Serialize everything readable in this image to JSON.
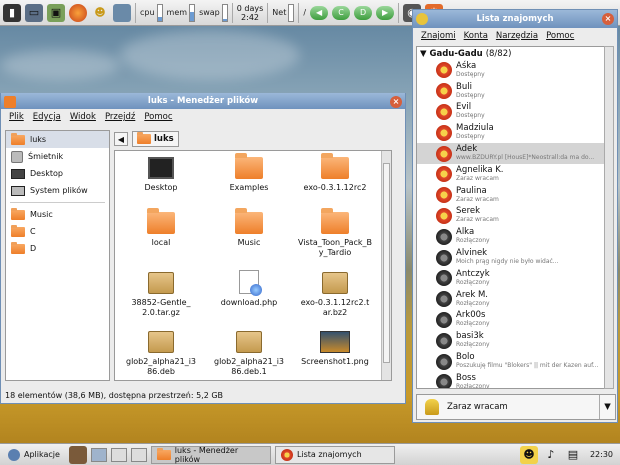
{
  "top_panel": {
    "launchers": [
      "terminal-icon",
      "display-icon",
      "image-icon",
      "firefox-icon",
      "user-icon",
      "workspace-icon"
    ],
    "cpu_label": "cpu",
    "cpu_level": 0.2,
    "mem_label": "mem",
    "mem_level": 0.55,
    "swap_label": "swap",
    "swap_level": 0.1,
    "uptime_days": "0 days",
    "uptime_time": "2:42",
    "net_label": "Net",
    "slash": "/",
    "drives": [
      "C",
      "D"
    ]
  },
  "file_manager": {
    "title": "luks - Menedżer plików",
    "menu": [
      "Plik",
      "Edycja",
      "Widok",
      "Przejdź",
      "Pomoc"
    ],
    "sidebar": [
      {
        "label": "luks",
        "icon": "home-folder-icon",
        "selected": true
      },
      {
        "label": "Śmietnik",
        "icon": "trash-icon"
      },
      {
        "label": "Desktop",
        "icon": "desktop-icon"
      },
      {
        "label": "System plików",
        "icon": "drive-icon"
      },
      {
        "label": "Music",
        "icon": "folder-icon"
      },
      {
        "label": "C",
        "icon": "folder-icon"
      },
      {
        "label": "D",
        "icon": "folder-icon"
      }
    ],
    "path_button": "luks",
    "files": [
      {
        "name": "Desktop",
        "icon": "film-icon"
      },
      {
        "name": "Examples",
        "icon": "folder-icon"
      },
      {
        "name": "exo-0.3.1.12rc2",
        "icon": "folder-icon"
      },
      {
        "name": "local",
        "icon": "folder-icon"
      },
      {
        "name": "Music",
        "icon": "folder-icon"
      },
      {
        "name": "Vista_Toon_Pack_By_Tardio",
        "icon": "folder-icon"
      },
      {
        "name": "38852-Gentle_2.0.tar.gz",
        "icon": "package-icon"
      },
      {
        "name": "download.php",
        "icon": "php-icon"
      },
      {
        "name": "exo-0.3.1.12rc2.tar.bz2",
        "icon": "package-icon"
      },
      {
        "name": "glob2_alpha21_i386.deb",
        "icon": "package-icon"
      },
      {
        "name": "glob2_alpha21_i386.deb.1",
        "icon": "package-icon"
      },
      {
        "name": "Screenshot1.png",
        "icon": "image-icon"
      }
    ],
    "status": "18 elementów (38,6 MB), dostępna przestrzeń: 5,2 GB"
  },
  "messenger": {
    "title": "Lista znajomych",
    "menu": [
      "Znajomi",
      "Konta",
      "Narzędzia",
      "Pomoc"
    ],
    "group_name": "Gadu-Gadu",
    "group_count": "(8/82)",
    "contacts": [
      {
        "name": "Aśka",
        "status": "Dostępny",
        "online": true
      },
      {
        "name": "Buli",
        "status": "Dostępny",
        "online": true
      },
      {
        "name": "Evil",
        "status": "Dostępny",
        "online": true
      },
      {
        "name": "Madziula",
        "status": "Dostępny",
        "online": true
      },
      {
        "name": "Adek",
        "status": "www.BZDURY.pl [HousE]*Neostrall:da ma do...",
        "online": true,
        "selected": true
      },
      {
        "name": "Agnelika K.",
        "status": "Zaraz wracam",
        "online": true
      },
      {
        "name": "Paulina",
        "status": "Zaraz wracam",
        "online": true
      },
      {
        "name": "Serek",
        "status": "Zaraz wracam",
        "online": true
      },
      {
        "name": "Alka",
        "status": "Rozłączony",
        "online": false
      },
      {
        "name": "Alvinek",
        "status": "Moich prąg nigdy nie było widać...",
        "online": false
      },
      {
        "name": "Antczyk",
        "status": "Rozłączony",
        "online": false
      },
      {
        "name": "Arek M.",
        "status": "Rozłączony",
        "online": false
      },
      {
        "name": "Ark00s",
        "status": "Rozłączony",
        "online": false
      },
      {
        "name": "basi3k",
        "status": "Rozłączony",
        "online": false
      },
      {
        "name": "Bolo",
        "status": "Poszukuję filmu \"Blokers\" || mit der Kazen auf...",
        "online": false
      },
      {
        "name": "Boss",
        "status": "Rozłączony",
        "online": false
      }
    ],
    "my_status": "Zaraz wracam"
  },
  "bottom_panel": {
    "menu_label": "Aplikacje",
    "tasks": [
      "luks - Menedżer plików",
      "Lista znajomych"
    ],
    "clock": "22:30"
  }
}
